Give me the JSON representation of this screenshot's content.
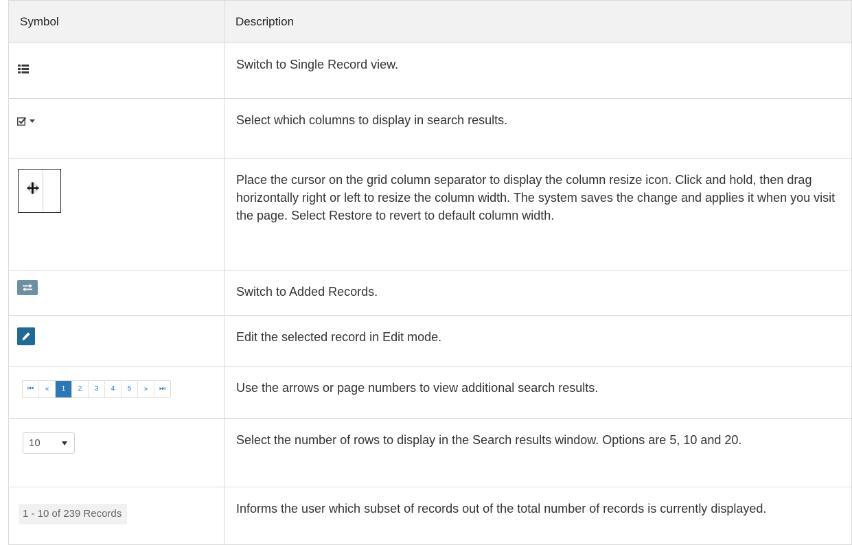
{
  "table": {
    "headers": {
      "symbol": "Symbol",
      "description": "Description"
    },
    "rows": [
      {
        "icon": "list-view-icon",
        "description": "Switch to Single Record view."
      },
      {
        "icon": "column-select-checkbox-icon",
        "description": "Select which columns to display in search results."
      },
      {
        "icon": "column-resize-cursor-icon",
        "description": "Place the cursor on the grid column separator to display the column resize icon. Click and hold, then drag horizontally right or left to resize the column width. The system saves the change and applies it when you visit the page. Select Restore to revert to default column width."
      },
      {
        "icon": "switch-arrows-icon",
        "description": "Switch to Added Records."
      },
      {
        "icon": "pencil-icon",
        "description": "Edit the selected record in Edit mode."
      },
      {
        "icon": "pagination-control",
        "description": "Use the arrows or page numbers to view additional search results."
      },
      {
        "icon": "rows-per-page-select",
        "description": "Select the number of rows to display in the Search results window. Options are 5, 10 and 20."
      },
      {
        "icon": "record-count-label",
        "description": "Informs the user which subset of records out of the total number of records is currently displayed."
      }
    ]
  },
  "pager": {
    "first": "⏮",
    "prev": "«",
    "pages": [
      "1",
      "2",
      "3",
      "4",
      "5"
    ],
    "active_page": "1",
    "next": "»",
    "last": "⏭"
  },
  "rows_select": {
    "value": "10"
  },
  "record_count": {
    "text": "1 - 10 of 239 Records"
  },
  "colors": {
    "switch_button": "#6d8fa3",
    "edit_button": "#1f6a97",
    "pager_active": "#2a78b5",
    "header_bg": "#f2f2f2"
  }
}
